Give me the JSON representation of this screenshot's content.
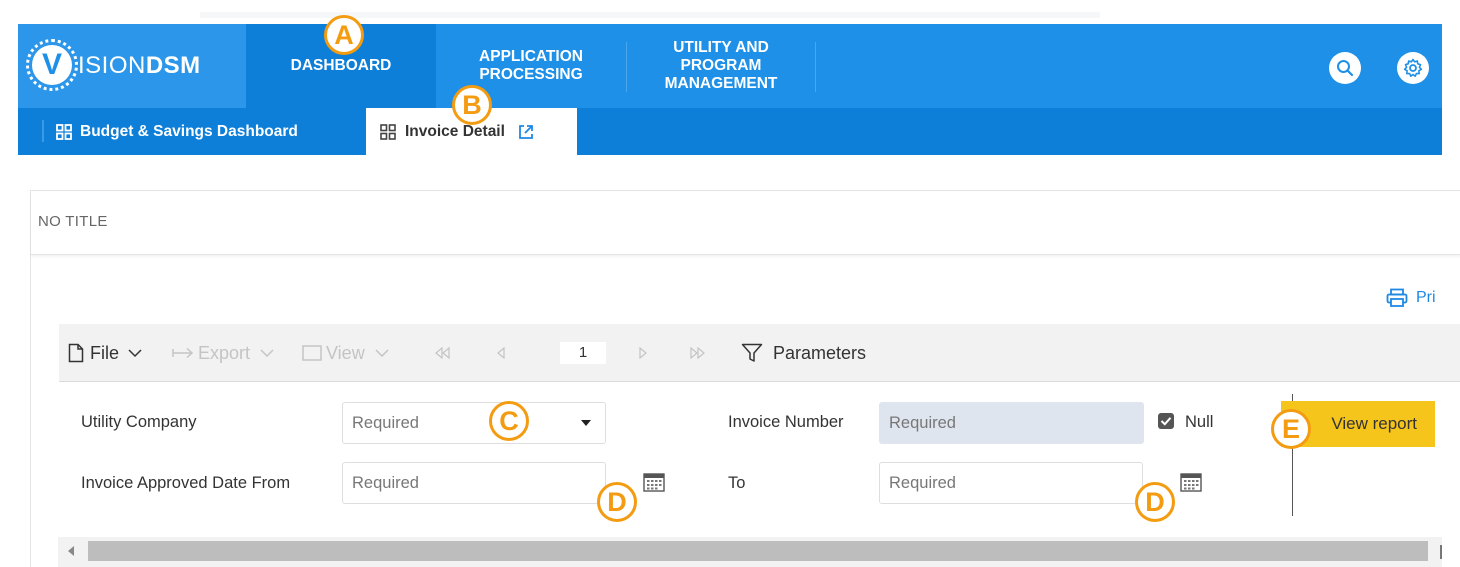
{
  "logo": {
    "letter": "V",
    "text_regular": "ISION",
    "text_bold": "DSM"
  },
  "nav": {
    "tabs": [
      {
        "label": "DASHBOARD"
      },
      {
        "label_lines": [
          "APPLICATION",
          "PROCESSING"
        ]
      },
      {
        "label_lines": [
          "UTILITY AND",
          "PROGRAM",
          "MANAGEMENT"
        ]
      }
    ]
  },
  "subnav": {
    "items": [
      {
        "label": "Budget & Savings Dashboard"
      },
      {
        "label": "Invoice Detail"
      }
    ]
  },
  "panel": {
    "title": "NO TITLE",
    "print_label": "Pri"
  },
  "toolbar": {
    "file": "File",
    "export": "Export",
    "view": "View",
    "page": "1",
    "parameters": "Parameters"
  },
  "params": {
    "utility_company_label": "Utility Company",
    "utility_company_placeholder": "Required",
    "invoice_number_label": "Invoice Number",
    "invoice_number_placeholder": "Required",
    "null_label": "Null",
    "approved_from_label": "Invoice Approved Date From",
    "approved_from_placeholder": "Required",
    "to_label": "To",
    "to_placeholder": "Required",
    "view_report": "View report"
  },
  "callouts": {
    "a": "A",
    "b": "B",
    "c": "C",
    "d1": "D",
    "d2": "D",
    "e": "E"
  },
  "colors": {
    "nav_blue": "#1e90e8",
    "subnav_blue": "#0d7fd9",
    "button_yellow": "#f5c51c",
    "callout_orange": "#f39c12"
  }
}
